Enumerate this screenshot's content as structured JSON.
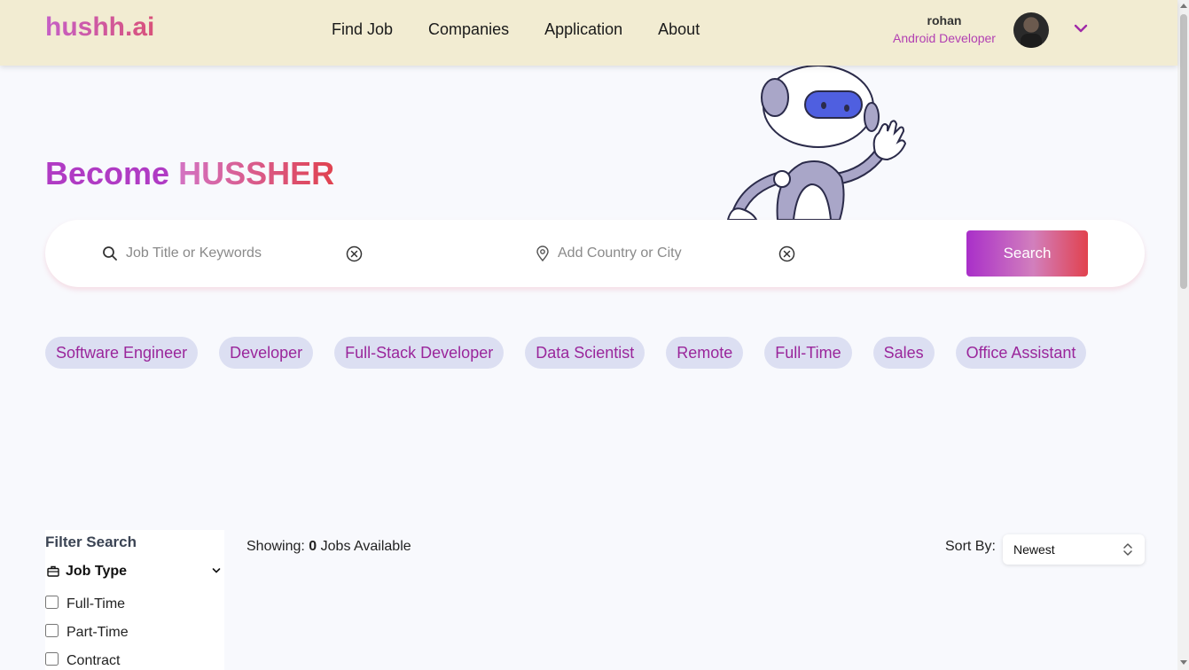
{
  "header": {
    "logo": "hushh.ai",
    "nav": [
      "Find Job",
      "Companies",
      "Application",
      "About"
    ],
    "user": {
      "name": "rohan",
      "role": "Android Developer"
    }
  },
  "hero": {
    "title_part1": "Become",
    "title_part2": "HUSSHER"
  },
  "search": {
    "keyword_placeholder": "Job Title or Keywords",
    "location_placeholder": "Add Country or City",
    "button": "Search"
  },
  "chips": [
    "Software Engineer",
    "Developer",
    "Full-Stack Developer",
    "Data Scientist",
    "Remote",
    "Full-Time",
    "Sales",
    "Office Assistant"
  ],
  "filter": {
    "title": "Filter Search",
    "section": "Job Type",
    "options": [
      "Full-Time",
      "Part-Time",
      "Contract"
    ]
  },
  "results": {
    "showing_label": "Showing:",
    "count": "0",
    "suffix": "Jobs Available",
    "sort_label": "Sort By:",
    "sort_value": "Newest"
  },
  "colors": {
    "header_bg": "#f2ecd2",
    "accent_purple": "#b03bc4",
    "accent_red": "#e1424e",
    "chip_bg": "#dcdff2",
    "chip_text": "#9a269b"
  }
}
